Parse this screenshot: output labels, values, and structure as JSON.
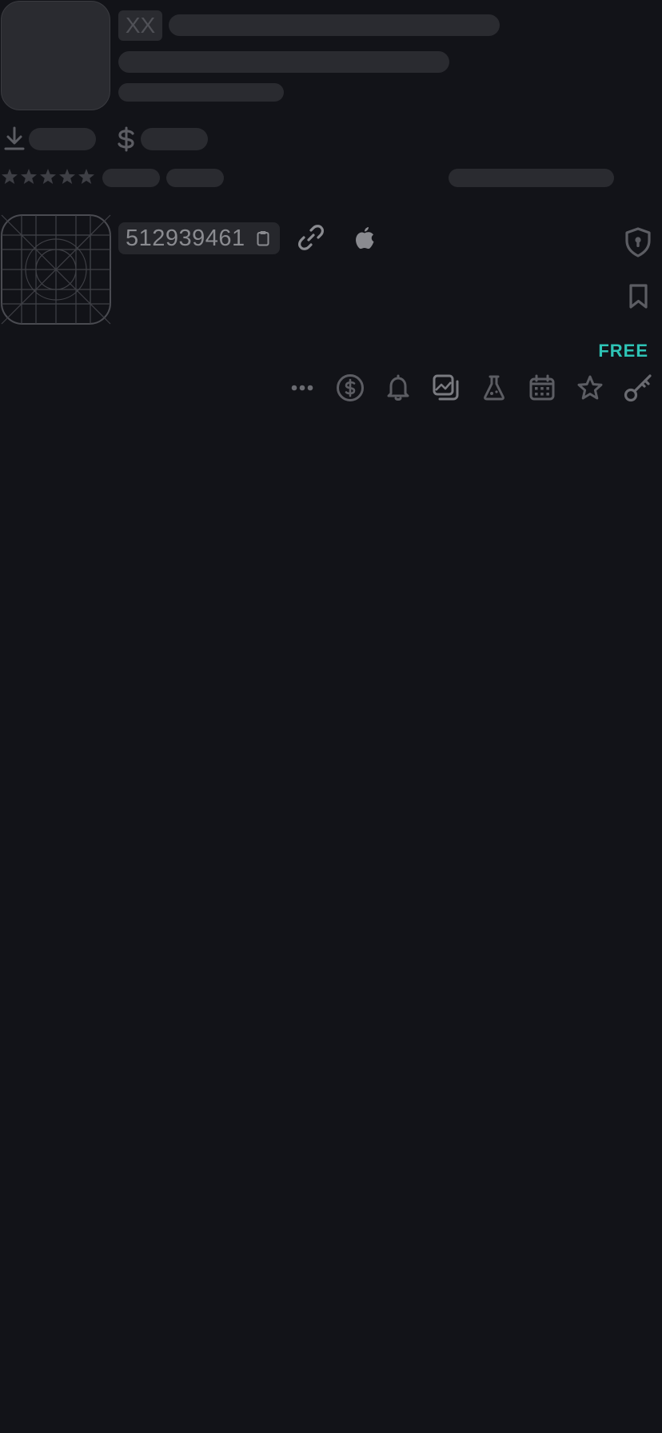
{
  "header": {
    "placeholder_code": "XX"
  },
  "app": {
    "id": "512939461",
    "price_label": "FREE"
  },
  "icons": {
    "download": "download-icon",
    "price": "dollar-icon",
    "rating": "star-icon",
    "copy": "clipboard-icon",
    "link": "link-icon",
    "platform": "apple-icon",
    "privacy": "shield-lock-icon",
    "bookmark": "bookmark-icon",
    "toolbar": [
      "more-icon",
      "dollar-circle-icon",
      "bell-icon",
      "screenshots-icon",
      "flask-icon",
      "calendar-icon",
      "star-outline-icon",
      "key-icon"
    ]
  },
  "colors": {
    "background": "#121318",
    "skeleton": "#2a2b30",
    "icon": "#5c5d63",
    "accent": "#2ec4b6"
  }
}
